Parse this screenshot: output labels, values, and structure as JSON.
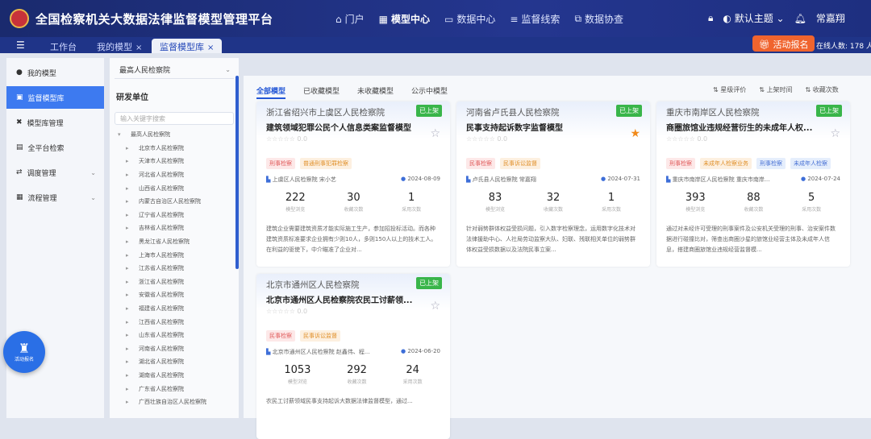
{
  "header": {
    "app_title": "全国检察机关大数据法律监督模型管理平台",
    "nav": [
      {
        "icon": "home-icon",
        "glyph": "⌂",
        "label": "门户"
      },
      {
        "icon": "grid-icon",
        "glyph": "▦",
        "label": "模型中心"
      },
      {
        "icon": "chart-icon",
        "glyph": "▭",
        "label": "数据中心"
      },
      {
        "icon": "list-icon",
        "glyph": "≡",
        "label": "监督线索"
      },
      {
        "icon": "sync-icon",
        "glyph": "⧉",
        "label": "数据协查"
      }
    ],
    "theme_label": "默认主题",
    "user_name": "常嘉翔"
  },
  "tabs": [
    {
      "label": "工作台"
    },
    {
      "label": "我的模型",
      "close": "×"
    },
    {
      "label": "监督模型库",
      "close": "×"
    }
  ],
  "activity_button": "活动报名",
  "online_text": "在线人数: 178 人",
  "sidebar": {
    "items": [
      {
        "icon": "model-icon",
        "label": "我的模型"
      },
      {
        "icon": "library-icon",
        "label": "监督模型库"
      },
      {
        "icon": "tools-icon",
        "label": "模型库管理"
      },
      {
        "icon": "search-icon",
        "label": "全平台检索"
      },
      {
        "icon": "dispatch-icon",
        "label": "调度管理",
        "arrow": "⌄"
      },
      {
        "icon": "process-icon",
        "label": "流程管理",
        "arrow": "⌄"
      }
    ]
  },
  "tree": {
    "select_value": "最高人民检察院",
    "heading": "研发单位",
    "search_placeholder": "输入关键字搜索",
    "root": "最高人民检察院",
    "children": [
      "北京市人民检察院",
      "天津市人民检察院",
      "河北省人民检察院",
      "山西省人民检察院",
      "内蒙古自治区人民检察院",
      "辽宁省人民检察院",
      "吉林省人民检察院",
      "黑龙江省人民检察院",
      "上海市人民检察院",
      "江苏省人民检察院",
      "浙江省人民检察院",
      "安徽省人民检察院",
      "福建省人民检察院",
      "江西省人民检察院",
      "山东省人民检察院",
      "河南省人民检察院",
      "湖北省人民检察院",
      "湖南省人民检察院",
      "广东省人民检察院",
      "广西壮族自治区人民检察院"
    ]
  },
  "float_button": "活动报名",
  "filter_tabs": [
    "全部模型",
    "已收藏模型",
    "未收藏模型",
    "公示中模型"
  ],
  "sort_options": [
    "星级评价",
    "上架时间",
    "收藏次数"
  ],
  "cards": [
    {
      "org": "浙江省绍兴市上虞区人民检察院",
      "badge": "已上架",
      "name": "建筑领域犯罪公民个人信息类案监督模型",
      "starred": false,
      "rating_text": "☆☆☆☆☆ 0.0",
      "tags": [
        {
          "text": "刑事检察",
          "color": "red"
        },
        {
          "text": "普通刑事犯罪检察",
          "color": "orange"
        }
      ],
      "unit": "上虞区人民检察院 宋小艺",
      "date": "2024-08-09",
      "stats": [
        {
          "value": "222",
          "label": "模型浏览"
        },
        {
          "value": "30",
          "label": "收藏次数"
        },
        {
          "value": "1",
          "label": "采用次数"
        }
      ],
      "desc": "建筑企业需要建筑资质才能实际施工生产，参加招投标活动。而各种建筑资质标准要求企业拥有少则10人，多则150人以上的技术工人。在利益的驱使下，中介瞄准了企业对..."
    },
    {
      "org": "河南省卢氏县人民检察院",
      "badge": "已上架",
      "name": "民事支持起诉数字监督模型",
      "starred": true,
      "rating_text": "☆☆☆☆☆ 0.0",
      "tags": [
        {
          "text": "民事检察",
          "color": "red"
        },
        {
          "text": "民事诉讼监督",
          "color": "orange"
        }
      ],
      "unit": "卢氏县人民检察院 常嘉翔",
      "date": "2024-07-31",
      "stats": [
        {
          "value": "83",
          "label": "模型浏览"
        },
        {
          "value": "32",
          "label": "收藏次数"
        },
        {
          "value": "1",
          "label": "采用次数"
        }
      ],
      "desc": "针对弱势群体权益受损问题，引入数字检察理念，运用数字化技术对法律援助中心、人社局劳动监察大队、妇联、残联相关单位的弱势群体权益受损数据以及法院民事立案..."
    },
    {
      "org": "重庆市南岸区人民检察院",
      "badge": "已上架",
      "name": "商圈旅馆业违规经营衍生的未成年人权...",
      "starred": false,
      "rating_text": "☆☆☆☆☆ 0.0",
      "tags": [
        {
          "text": "刑事检察",
          "color": "red"
        },
        {
          "text": "未成年人检察业务",
          "color": "orange"
        },
        {
          "text": "刑事检察",
          "color": "blue"
        },
        {
          "text": "未成年人检察",
          "color": "blue"
        }
      ],
      "unit": "重庆市南岸区人民检察院 重庆市南岸...",
      "date": "2024-07-24",
      "stats": [
        {
          "value": "393",
          "label": "模型浏览"
        },
        {
          "value": "88",
          "label": "收藏次数"
        },
        {
          "value": "5",
          "label": "采用次数"
        }
      ],
      "desc": "通过对未经许可受理的刑事案件及公安机关受理的刑事、治安案件数据进行碰撞比对，筛查出商圈沙星的旅馆业经营主体及未成年人信息，搭建商圈旅馆业违规经营监督模..."
    },
    {
      "org": "北京市通州区人民检察院",
      "badge": "已上架",
      "name": "北京市通州区人民检察院农民工讨薪领...",
      "starred": false,
      "rating_text": "☆☆☆☆☆ 0.0",
      "tags": [
        {
          "text": "民事检察",
          "color": "red"
        },
        {
          "text": "民事诉讼监督",
          "color": "orange"
        }
      ],
      "unit": "北京市通州区人民检察院 赵鑫伟、程...",
      "date": "2024-06-20",
      "stats": [
        {
          "value": "1053",
          "label": "模型浏览"
        },
        {
          "value": "292",
          "label": "收藏次数"
        },
        {
          "value": "24",
          "label": "采用次数"
        }
      ],
      "desc": "农民工讨薪领域民事支持起诉大数据法律监督模型，通过..."
    }
  ]
}
